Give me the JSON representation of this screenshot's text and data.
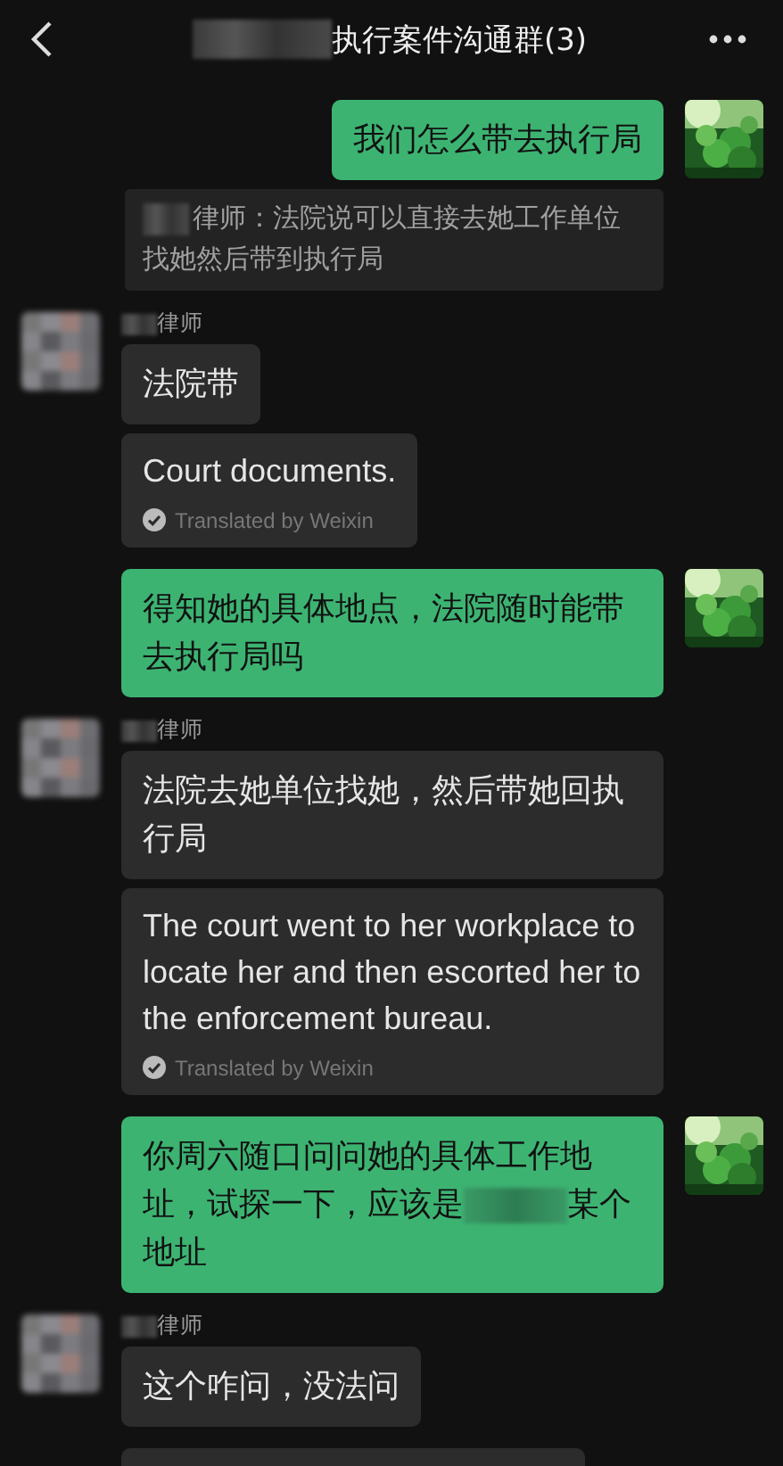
{
  "header": {
    "title": "执行案件沟通群(3)",
    "title_redacted": true
  },
  "messages": [
    {
      "kind": "sent",
      "parts": [
        "我们怎么带去执行局"
      ],
      "quote": {
        "sender": "律师：",
        "text": "法院说可以直接去她工作单位找她然后带到执行局"
      }
    },
    {
      "kind": "received",
      "sender": "律师",
      "bubbles": [
        {
          "kind": "text",
          "text": "法院带"
        },
        {
          "kind": "translation",
          "text": "Court documents.",
          "note": "Translated by Weixin"
        }
      ]
    },
    {
      "kind": "sent",
      "parts": [
        "得知她的具体地点，法院随时能带去执行局吗"
      ]
    },
    {
      "kind": "received",
      "sender": "律师",
      "bubbles": [
        {
          "kind": "text",
          "text": "法院去她单位找她，然后带她回执行局"
        },
        {
          "kind": "translation",
          "text": "The court went to her workplace to locate her and then escorted her to the enforcement bureau.",
          "note": "Translated by Weixin"
        }
      ]
    },
    {
      "kind": "sent",
      "parts": [
        "你周六随口问问她的具体工作地址，试探一下，应该是",
        "某个地址"
      ]
    },
    {
      "kind": "received",
      "sender": "律师",
      "bubbles": [
        {
          "kind": "text",
          "text": "这个咋问，没法问"
        }
      ]
    }
  ]
}
